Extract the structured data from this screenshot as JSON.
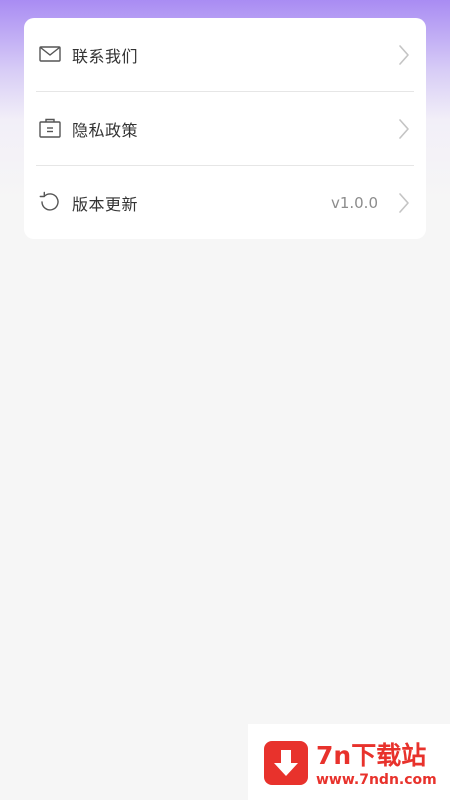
{
  "settings": {
    "items": [
      {
        "label": "联系我们",
        "icon": "mail-icon",
        "value": ""
      },
      {
        "label": "隐私政策",
        "icon": "briefcase-icon",
        "value": ""
      },
      {
        "label": "版本更新",
        "icon": "refresh-icon",
        "value": "v1.0.0"
      }
    ]
  },
  "watermark": {
    "title": "7n下载站",
    "url": "www.7ndn.com",
    "icon": "download-arrow-icon",
    "color": "#e8322c"
  },
  "colors": {
    "header_gradient_top": "#a98cf3",
    "background": "#f6f6f6",
    "card": "#ffffff"
  }
}
